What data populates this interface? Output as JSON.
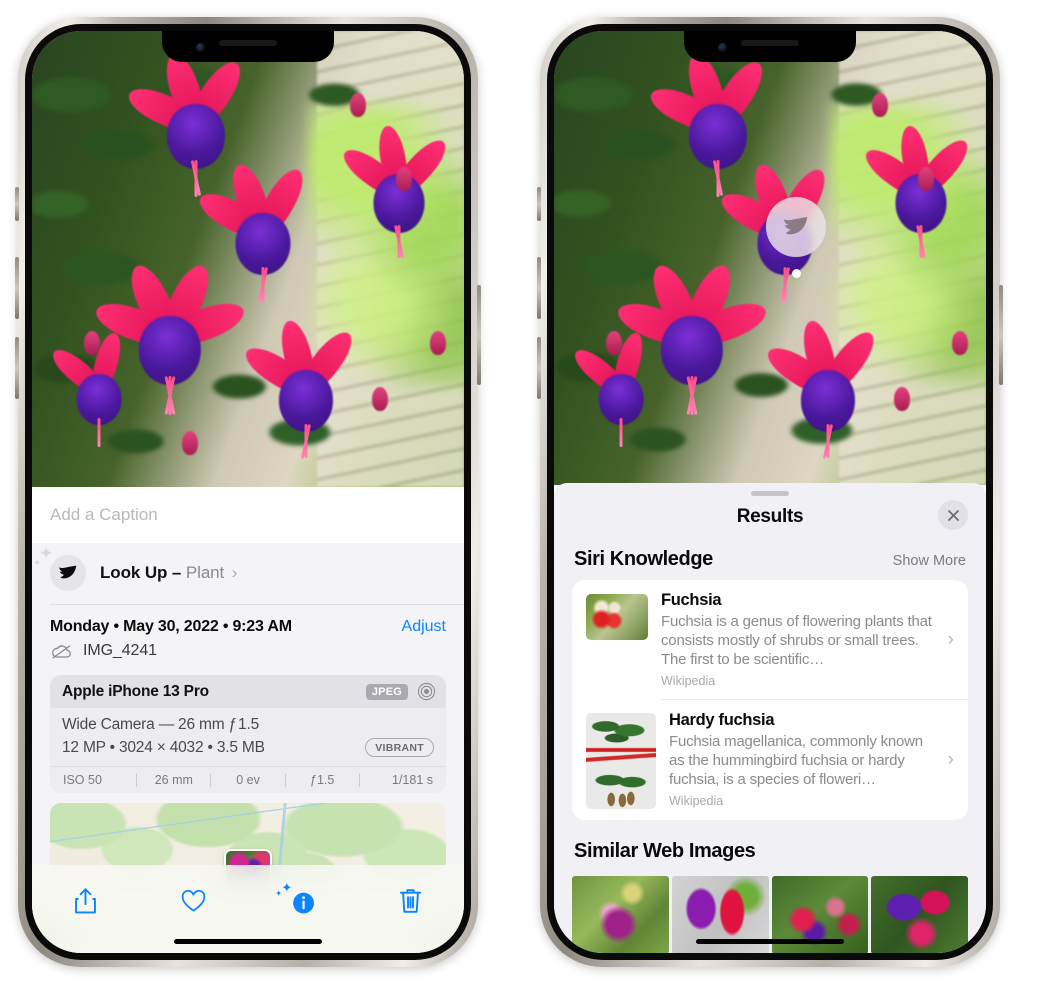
{
  "left_phone": {
    "caption_placeholder": "Add a Caption",
    "lookup": {
      "label": "Look Up",
      "dash": "–",
      "subject": "Plant",
      "chevron": "›",
      "icon": "leaf-icon"
    },
    "metadata": {
      "date_line": "Monday • May 30, 2022 • 9:23 AM",
      "adjust_label": "Adjust",
      "cloud_icon": "cloud-slash-icon",
      "filename": "IMG_4241"
    },
    "exif": {
      "device": "Apple iPhone 13 Pro",
      "format_badge": "JPEG",
      "hdr_icon": "aperture-icon",
      "lens_line": "Wide Camera — 26 mm ƒ 1.5",
      "size_line": "12 MP • 3024 × 4032 • 3.5 MB",
      "style_badge": "VIBRANT",
      "stats": [
        "ISO 50",
        "26 mm",
        "0 ev",
        "ƒ1.5",
        "1/181 s"
      ]
    },
    "toolbar": [
      {
        "name": "share-button",
        "icon": "share-icon"
      },
      {
        "name": "favorite-button",
        "icon": "heart-icon"
      },
      {
        "name": "info-button",
        "icon": "info-sparkle-icon"
      },
      {
        "name": "delete-button",
        "icon": "trash-icon"
      }
    ],
    "accent_color": "#0a84ff"
  },
  "right_phone": {
    "badge": {
      "icon": "leaf-icon",
      "name": "visual-look-up-badge"
    },
    "sheet": {
      "title": "Results",
      "close_icon": "close-icon",
      "siri_knowledge": {
        "heading": "Siri Knowledge",
        "show_more": "Show More",
        "results": [
          {
            "title": "Fuchsia",
            "description": "Fuchsia is a genus of flowering plants that consists mostly of shrubs or small trees. The first to be scientific…",
            "source": "Wikipedia",
            "thumb": "fuchsia-red-flowers-thumbnail"
          },
          {
            "title": "Hardy fuchsia",
            "description": "Fuchsia magellanica, commonly known as the hummingbird fuchsia or hardy fuchsia, is a species of floweri…",
            "source": "Wikipedia",
            "thumb": "hardy-fuchsia-specimen-thumbnail"
          }
        ]
      },
      "similar_web_images": {
        "heading": "Similar Web Images",
        "images": [
          "fuchsia-magenta-white-bloom",
          "fuchsia-red-purple-closeup",
          "fuchsia-bush-red-blooms",
          "fuchsia-purple-pink-cluster"
        ]
      }
    }
  }
}
